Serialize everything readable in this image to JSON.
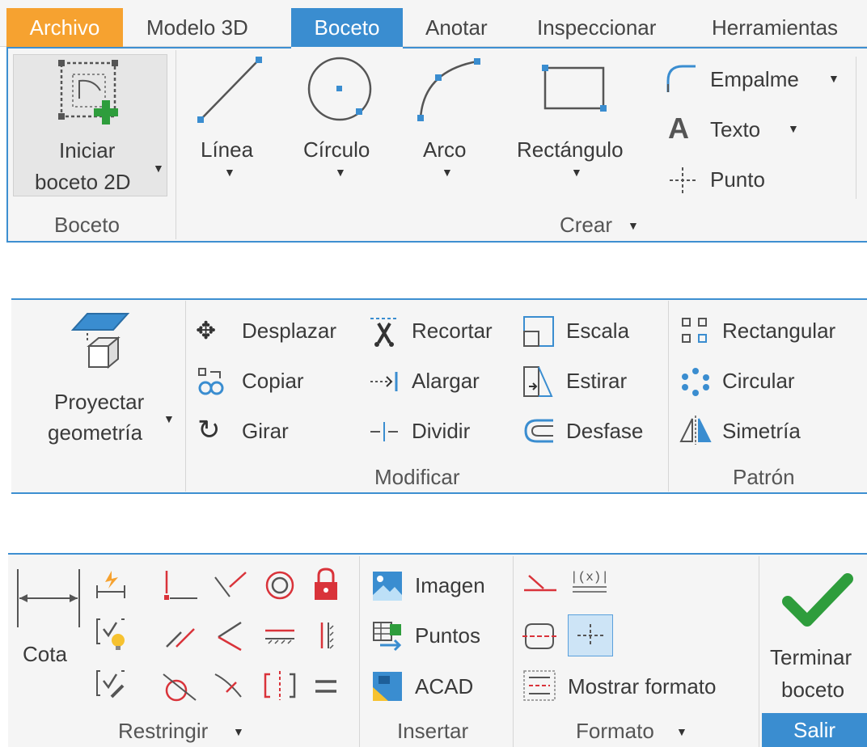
{
  "tabs": {
    "file": "Archivo",
    "model": "Modelo 3D",
    "sketch": "Boceto",
    "annotate": "Anotar",
    "inspect": "Inspeccionar",
    "tools": "Herramientas"
  },
  "boceto_panel": {
    "start_line1": "Iniciar",
    "start_line2": "boceto 2D",
    "title": "Boceto"
  },
  "crear_panel": {
    "line": "Línea",
    "circle": "Círculo",
    "arc": "Arco",
    "rectangle": "Rectángulo",
    "fillet": "Empalme",
    "text": "Texto",
    "point": "Punto",
    "title": "Crear"
  },
  "modificar_panel": {
    "project_line1": "Proyectar",
    "project_line2": "geometría",
    "move": "Desplazar",
    "copy": "Copiar",
    "rotate": "Girar",
    "trim": "Recortar",
    "extend": "Alargar",
    "split": "Dividir",
    "scale": "Escala",
    "stretch": "Estirar",
    "offset": "Desfase",
    "title": "Modificar"
  },
  "patron_panel": {
    "rectangular": "Rectangular",
    "circular": "Circular",
    "mirror": "Simetría",
    "title": "Patrón"
  },
  "restringir_panel": {
    "dimension": "Cota",
    "title": "Restringir"
  },
  "insertar_panel": {
    "image": "Imagen",
    "points": "Puntos",
    "acad": "ACAD",
    "title": "Insertar"
  },
  "formato_panel": {
    "show_format": "Mostrar formato",
    "title": "Formato"
  },
  "salir_panel": {
    "finish_line1": "Terminar",
    "finish_line2": "boceto",
    "title": "Salir"
  },
  "colors": {
    "accent": "#3a8dd0",
    "file_tab": "#f6a230",
    "constraint_red": "#d9333a",
    "finish_green": "#2e9d3c"
  }
}
